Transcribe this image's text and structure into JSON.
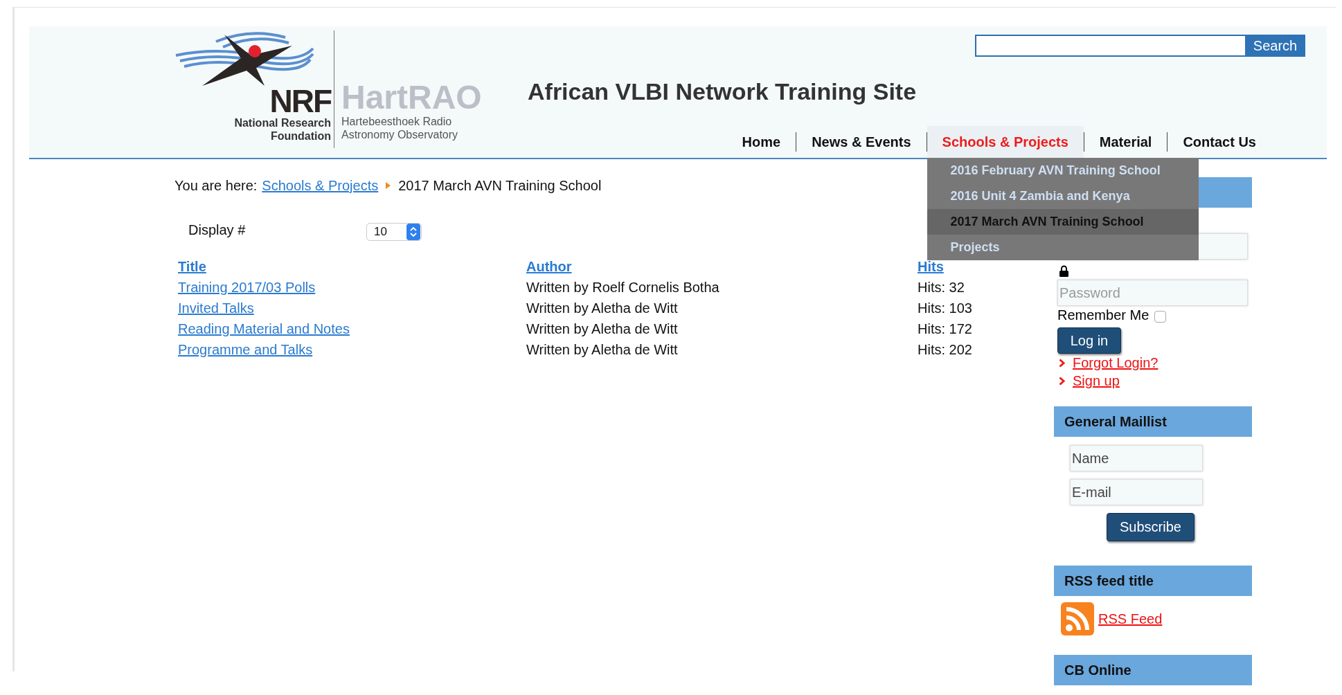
{
  "search": {
    "button": "Search"
  },
  "logo": {
    "mark": "NRF",
    "caption": [
      "National Research",
      "Foundation"
    ],
    "name": "HartRAO",
    "subtitle": [
      "Hartebeesthoek Radio",
      "Astronomy Observatory"
    ]
  },
  "site_title": "African VLBI Network Training Site",
  "nav": [
    {
      "label": "Home",
      "selected": false
    },
    {
      "label": "News & Events",
      "selected": false
    },
    {
      "label": "Schools & Projects",
      "selected": true,
      "expanded": true,
      "submenu": [
        {
          "label": "2016 February AVN Training School",
          "selected": false
        },
        {
          "label": "2016 Unit 4 Zambia and Kenya",
          "selected": false
        },
        {
          "label": "2017 March AVN Training School",
          "selected": true
        },
        {
          "label": "Projects",
          "selected": false
        }
      ]
    },
    {
      "label": "Material",
      "selected": false
    },
    {
      "label": "Contact Us",
      "selected": false
    }
  ],
  "breadcrumb": {
    "prefix": "You are here:",
    "items": [
      {
        "label": "Schools & Projects",
        "kind": "link"
      },
      {
        "label": "2017 March AVN Training School",
        "kind": "current"
      }
    ]
  },
  "display": {
    "label": "Display #",
    "value": "10"
  },
  "table": {
    "columns": [
      "Title",
      "Author",
      "Hits"
    ],
    "rows": [
      {
        "title": "Training 2017/03 Polls",
        "author": "Written by Roelf Cornelis Botha",
        "hits": "Hits: 32"
      },
      {
        "title": "Invited Talks",
        "author": "Written by Aletha de Witt",
        "hits": "Hits: 103"
      },
      {
        "title": "Reading Material and Notes",
        "author": "Written by Aletha de Witt",
        "hits": "Hits: 172"
      },
      {
        "title": "Programme and Talks",
        "author": "Written by Aletha de Witt",
        "hits": "Hits: 202"
      }
    ]
  },
  "login": {
    "password_placeholder": "Password",
    "remember_label": "Remember Me",
    "remember_checked": false,
    "button": "Log in",
    "links": [
      "Forgot Login?",
      "Sign up"
    ]
  },
  "maillist": {
    "title": "General Maillist",
    "fields": [
      {
        "placeholder": "Name"
      },
      {
        "placeholder": "E-mail"
      }
    ],
    "button": "Subscribe"
  },
  "rss": {
    "title": "RSS feed title",
    "link": "RSS Feed"
  },
  "cb_online": {
    "title": "CB Online"
  }
}
